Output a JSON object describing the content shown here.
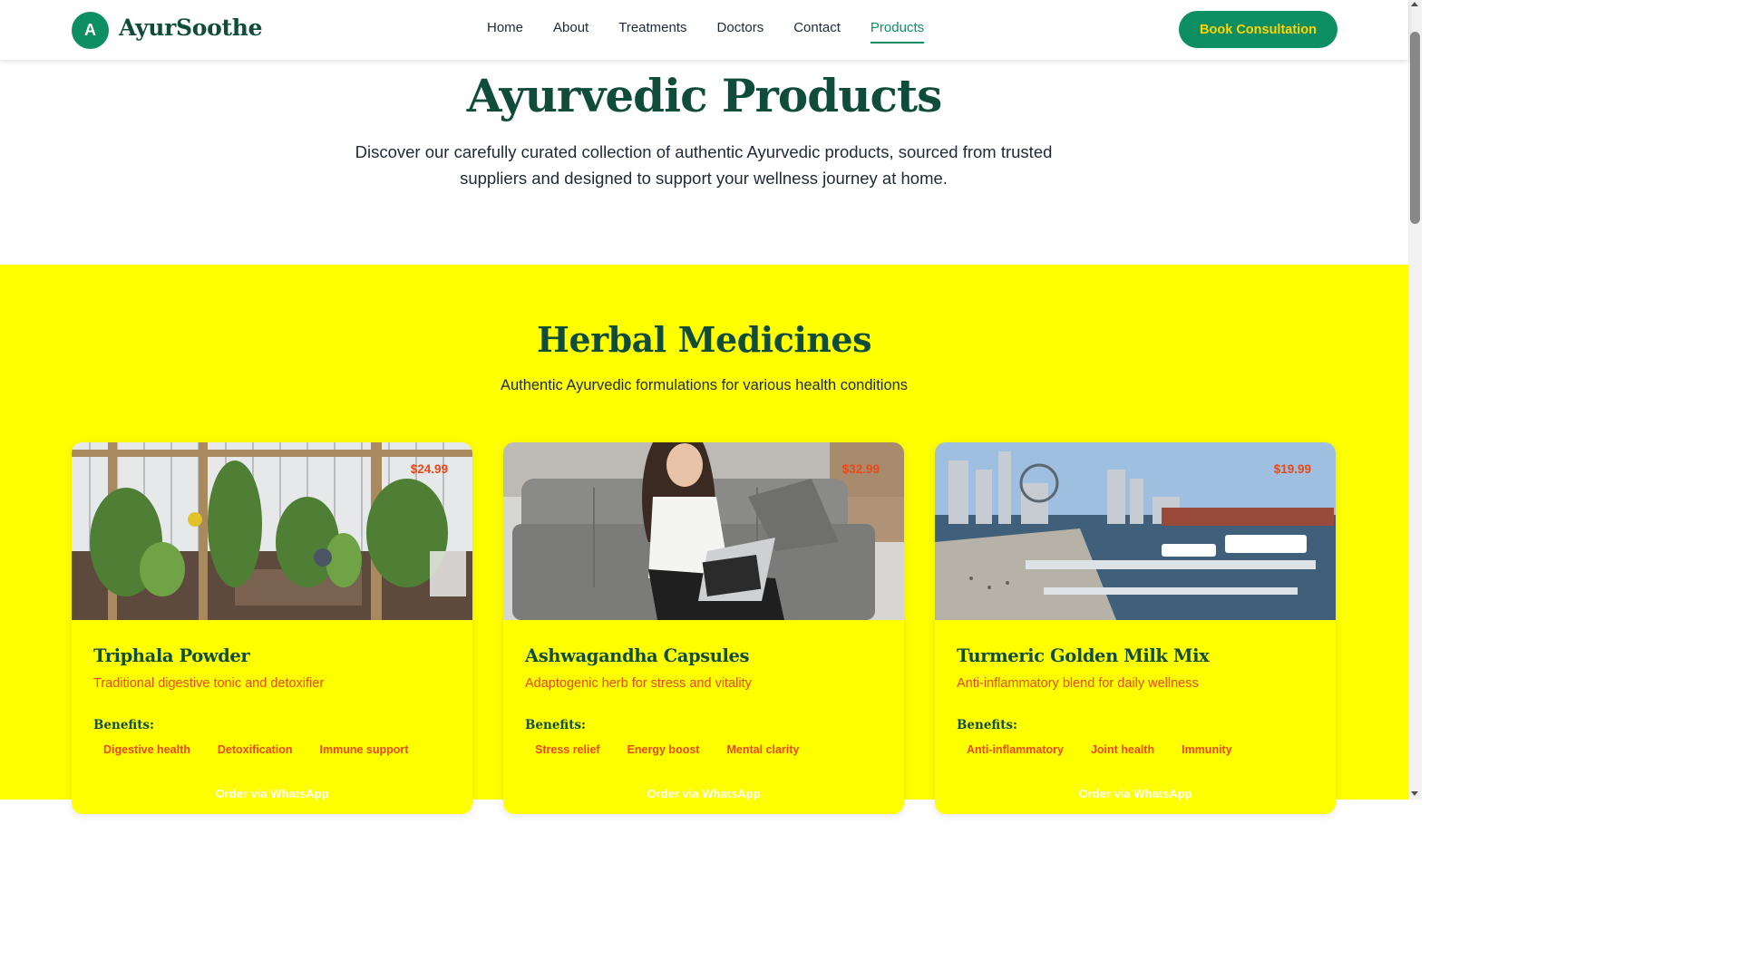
{
  "brand": {
    "logo_letter": "A",
    "name": "AyurSoothe"
  },
  "nav": {
    "items": [
      "Home",
      "About",
      "Treatments",
      "Doctors",
      "Contact",
      "Products"
    ],
    "active": "Products",
    "cta": "Book Consultation"
  },
  "hero": {
    "title": "Ayurvedic Products",
    "subtitle": "Discover our carefully curated collection of authentic Ayurvedic products, sourced from trusted suppliers and designed to support your wellness journey at home."
  },
  "section": {
    "title": "Herbal Medicines",
    "subtitle": "Authentic Ayurvedic formulations for various health conditions",
    "benefits_label": "Benefits:",
    "button_label": "Order via WhatsApp"
  },
  "products": [
    {
      "name": "Triphala Powder",
      "desc": "Traditional digestive tonic and detoxifier",
      "price": "$24.99",
      "benefits": [
        "Digestive health",
        "Detoxification",
        "Immune support"
      ]
    },
    {
      "name": "Ashwagandha Capsules",
      "desc": "Adaptogenic herb for stress and vitality",
      "price": "$32.99",
      "benefits": [
        "Stress relief",
        "Energy boost",
        "Mental clarity"
      ]
    },
    {
      "name": "Turmeric Golden Milk Mix",
      "desc": "Anti-inflammatory blend for daily wellness",
      "price": "$19.99",
      "benefits": [
        "Anti-inflammatory",
        "Joint health",
        "Immunity"
      ]
    }
  ],
  "colors": {
    "primary": "#0e8f63",
    "heading": "#0f4d3a",
    "accent": "#e64a19",
    "section_bg": "#ffff00"
  }
}
